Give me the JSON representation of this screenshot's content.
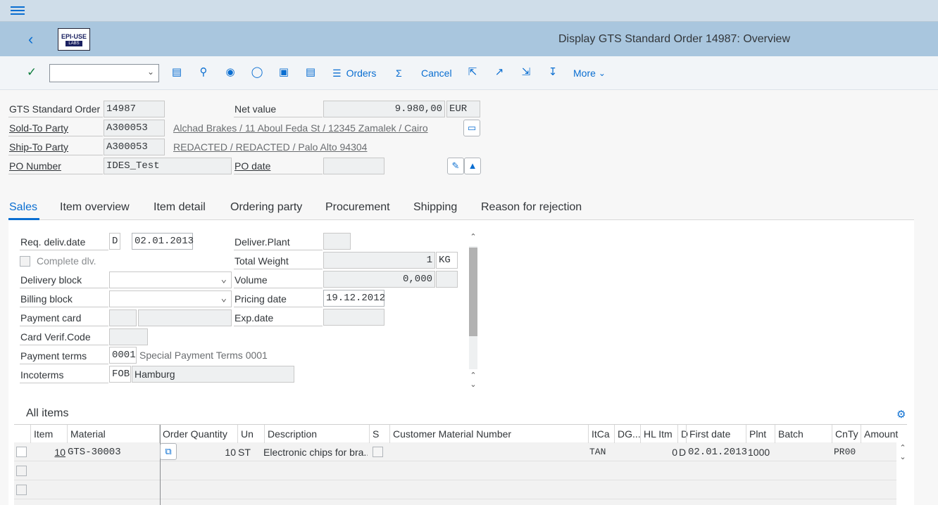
{
  "app": {
    "title": "Display GTS Standard Order 14987: Overview",
    "logo_text_top": "EPI-USE",
    "logo_text_bottom": "LABS"
  },
  "toolbar": {
    "orders_label": "Orders",
    "sum_symbol": "Σ",
    "cancel_label": "Cancel",
    "more_label": "More",
    "combo_value": ""
  },
  "header": {
    "order_type_label": "GTS Standard Order",
    "order_number": "14987",
    "net_value_label": "Net value",
    "net_value": "9.980,00",
    "currency": "EUR",
    "sold_to_label": "Sold-To Party",
    "sold_to_value": "A300053",
    "sold_to_address": "Alchad Brakes / 11 Aboul Feda St / 12345 Zamalek / Cairo",
    "ship_to_label": "Ship-To Party",
    "ship_to_value": "A300053",
    "ship_to_address": "REDACTED / REDACTED / Palo Alto 94304",
    "po_number_label": "PO Number",
    "po_number_value": "IDES_Test",
    "po_date_label": "PO date",
    "po_date_value": ""
  },
  "tabs": [
    {
      "label": "Sales",
      "selected": true
    },
    {
      "label": "Item overview"
    },
    {
      "label": "Item detail"
    },
    {
      "label": "Ordering party"
    },
    {
      "label": "Procurement"
    },
    {
      "label": "Shipping"
    },
    {
      "label": "Reason for rejection"
    }
  ],
  "sales": {
    "req_deliv_label": "Req. deliv.date",
    "req_deliv_type": "D",
    "req_deliv_date": "02.01.2013",
    "complete_dlv_label": "Complete dlv.",
    "delivery_block_label": "Delivery block",
    "billing_block_label": "Billing block",
    "payment_card_label": "Payment card",
    "card_verif_label": "Card Verif.Code",
    "payment_terms_label": "Payment terms",
    "payment_terms_code": "0001",
    "payment_terms_text": "Special Payment Terms 0001",
    "incoterms_label": "Incoterms",
    "incoterms_code": "FOB",
    "incoterms_place": "Hamburg",
    "deliver_plant_label": "Deliver.Plant",
    "total_weight_label": "Total Weight",
    "total_weight_value": "1",
    "total_weight_unit": "KG",
    "volume_label": "Volume",
    "volume_value": "0,000",
    "pricing_date_label": "Pricing date",
    "pricing_date_value": "19.12.2012",
    "exp_date_label": "Exp.date"
  },
  "items": {
    "section_title": "All items",
    "columns": [
      "Item",
      "Material",
      "Order Quantity",
      "Un",
      "Description",
      "S",
      "Customer Material Number",
      "ItCa",
      "DG...",
      "HL Itm",
      "D",
      "First date",
      "Plnt",
      "Batch",
      "CnTy",
      "Amount"
    ],
    "rows": [
      {
        "item": "10",
        "material": "GTS-30003",
        "qty": "10",
        "un": "ST",
        "description": "Electronic chips for bra...",
        "itca": "TAN",
        "hl_itm": "0",
        "d": "D",
        "first_date": "02.01.2013",
        "plnt": "1000",
        "cnty": "PR00"
      }
    ]
  }
}
